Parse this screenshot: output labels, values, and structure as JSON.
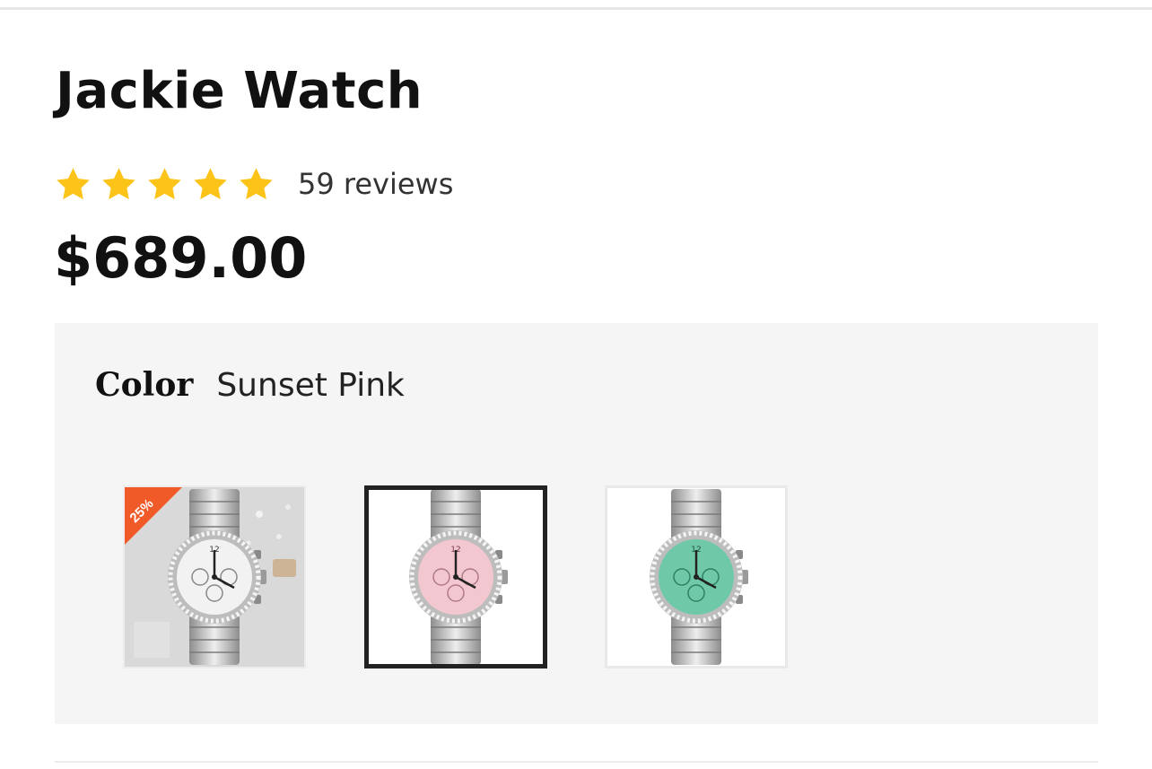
{
  "product": {
    "title": "Jackie Watch",
    "rating_stars": 5,
    "rating_max": 5,
    "star_color": "#fcc419",
    "reviews_label": "59 reviews",
    "price": "$689.00"
  },
  "variant": {
    "option_label": "Color",
    "selected_value": "Sunset Pink",
    "swatches": [
      {
        "name": "white",
        "dial_color": "#f2f2f2",
        "badge": "25%",
        "badge_color": "#f05a28",
        "selected": false
      },
      {
        "name": "sunset-pink",
        "dial_color": "#f2c7cf",
        "selected": true
      },
      {
        "name": "mint",
        "dial_color": "#6fc9a8",
        "selected": false
      }
    ]
  }
}
